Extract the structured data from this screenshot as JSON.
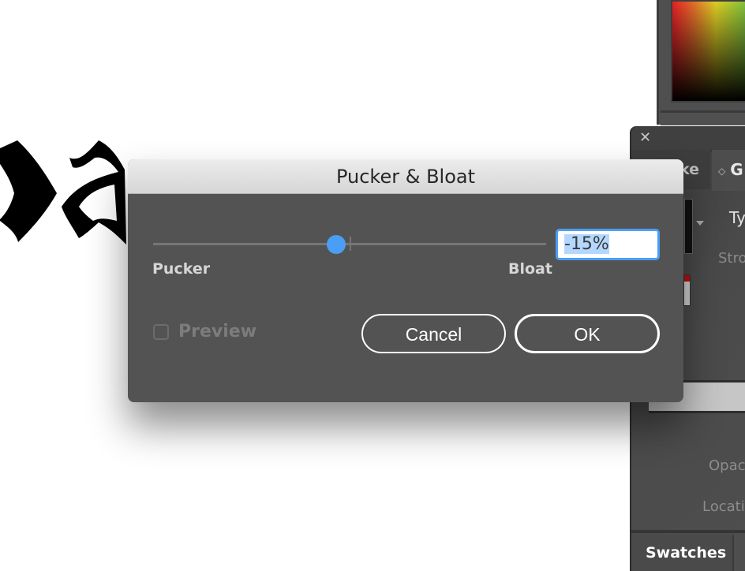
{
  "dialog": {
    "title": "Pucker & Bloat",
    "slider": {
      "min_label": "Pucker",
      "max_label": "Bloat",
      "value_percent": -15,
      "range": [
        -200,
        200
      ]
    },
    "value_input": "-15%",
    "preview": {
      "label": "Preview",
      "checked": false,
      "enabled": false
    },
    "buttons": {
      "cancel": "Cancel",
      "ok": "OK"
    },
    "accent_color": "#4a9ef5"
  },
  "gradient_panel": {
    "tabs": {
      "stroke_partial": "ke",
      "gradient_partial": "G",
      "gradient_arrows": "◇"
    },
    "type_label_partial": "Ty",
    "stroke_label_partial": "Stro",
    "opacity_label_partial": "Opac",
    "location_label_partial": "Locati",
    "close_glyph": "✕"
  },
  "bottom_panel": {
    "swatches_tab": "Swatches"
  },
  "artwork": {
    "text_partial": "oa"
  }
}
